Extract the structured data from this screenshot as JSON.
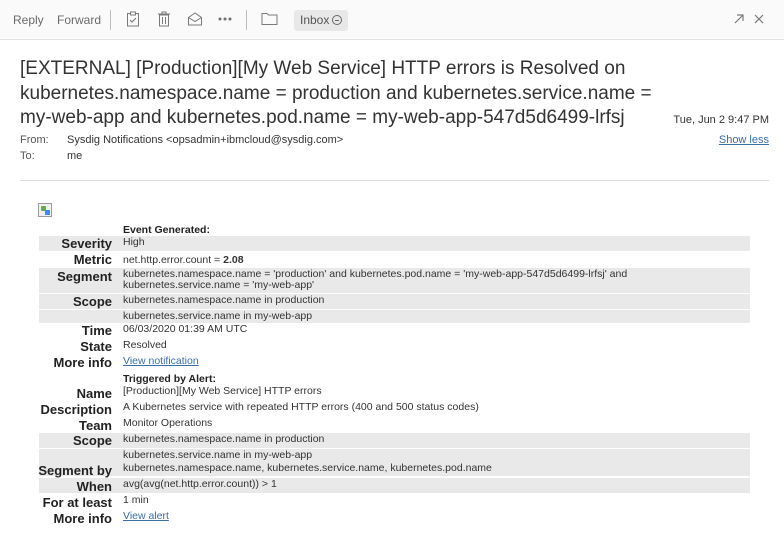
{
  "toolbar": {
    "reply_label": "Reply",
    "forward_label": "Forward",
    "icons": [
      "clipboard-icon",
      "trash-icon",
      "envelope-open-icon",
      "more-icon",
      "folder-icon",
      "popout-icon",
      "close-icon"
    ],
    "folder_pill_label": "Inbox"
  },
  "message": {
    "subject": "[EXTERNAL] [Production][My Web Service] HTTP errors is Resolved on kubernetes.namespace.name = production and kubernetes.service.name = my-web-app and kubernetes.pod.name = my-web-app-547d5d6499-lrfsj",
    "date": "Tue, Jun 2 9:47 PM",
    "from_label": "From:",
    "from_value": "Sysdig Notifications <opsadmin+ibmcloud@sysdig.com>",
    "to_label": "To:",
    "to_value": "me",
    "show_less": "Show less"
  },
  "event": {
    "heading": "Event Generated:",
    "severity_label": "Severity",
    "severity_value": "High",
    "metric_label": "Metric",
    "metric_prefix": "net.http.error.count = ",
    "metric_value": "2.08",
    "segment_label": "Segment",
    "segment_line1": "kubernetes.namespace.name = 'production' and kubernetes.pod.name = 'my-web-app-547d5d6499-lrfsj' and",
    "segment_line2": "kubernetes.service.name = 'my-web-app'",
    "scope_label": "Scope",
    "scope_line1": "kubernetes.namespace.name in production",
    "scope_line2": "kubernetes.service.name in my-web-app",
    "time_label": "Time",
    "time_value": "06/03/2020 01:39 AM UTC",
    "state_label": "State",
    "state_value": "Resolved",
    "moreinfo_label": "More info",
    "moreinfo_link": "View notification"
  },
  "alert": {
    "heading": "Triggered by Alert:",
    "name_label": "Name",
    "name_value": "[Production][My Web Service] HTTP errors",
    "description_label": "Description",
    "description_value": "A Kubernetes service with repeated HTTP errors (400 and 500 status codes)",
    "team_label": "Team",
    "team_value": "Monitor Operations",
    "scope_label": "Scope",
    "scope_line1": "kubernetes.namespace.name in production",
    "scope_line2": "kubernetes.service.name in my-web-app",
    "segmentby_label": "Segment by",
    "segmentby_value": "kubernetes.namespace.name, kubernetes.service.name, kubernetes.pod.name",
    "when_label": "When",
    "when_value": "avg(avg(net.http.error.count)) > 1",
    "foratleast_label": "For at least",
    "foratleast_value": "1 min",
    "moreinfo_label": "More info",
    "moreinfo_link": "View alert"
  }
}
